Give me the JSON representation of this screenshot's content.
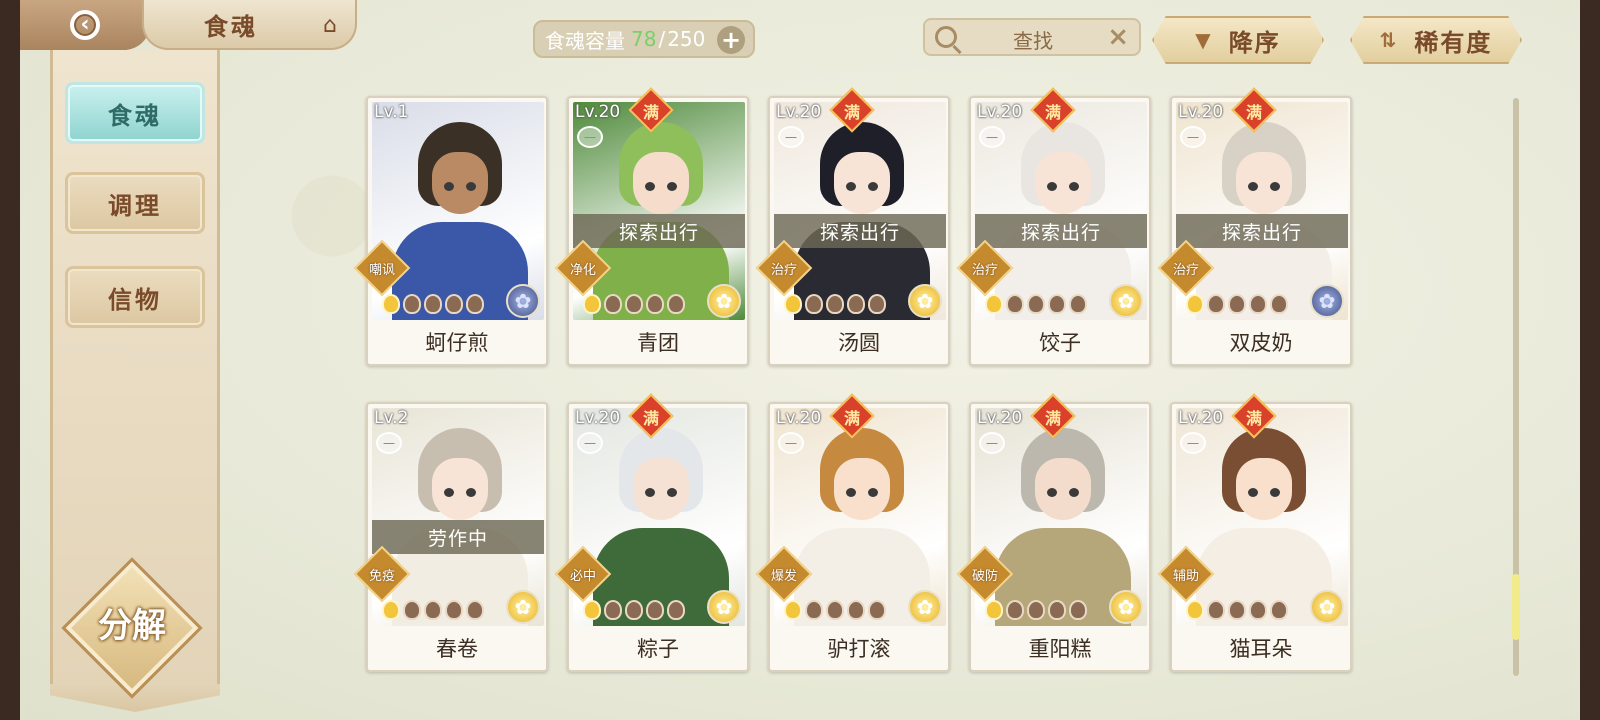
{
  "header": {
    "title": "食魂",
    "capacity_label": "食魂容量",
    "capacity_current": "78",
    "capacity_max": "250",
    "search_placeholder": "查找",
    "sort_order_label": "降序",
    "sort_by_label": "稀有度"
  },
  "sidebar": {
    "items": [
      {
        "label": "食魂",
        "active": true
      },
      {
        "label": "调理",
        "active": false
      },
      {
        "label": "信物",
        "active": false
      }
    ],
    "decompose_label": "分解"
  },
  "cards": [
    {
      "name": "蚵仔煎",
      "level": "Lv.1",
      "max": false,
      "badge": "",
      "status": "",
      "role": "嘲讽",
      "stars": 1,
      "rarity": "blue",
      "palette": {
        "bg": "#d9dde8",
        "hair": "#3b3025",
        "body": "#3a57a8",
        "skin": "#b98a63"
      }
    },
    {
      "name": "青团",
      "level": "Lv.20",
      "max": true,
      "max_label": "满",
      "badge": "一",
      "status": "探索出行",
      "role": "净化",
      "stars": 1,
      "rarity": "gold",
      "palette": {
        "bg": "#4e8a3a",
        "hair": "#8fbf5a",
        "body": "#7fb04a",
        "skin": "#f6dccb"
      }
    },
    {
      "name": "汤圆",
      "level": "Lv.20",
      "max": true,
      "max_label": "满",
      "badge": "一",
      "status": "探索出行",
      "role": "治疗",
      "stars": 1,
      "rarity": "gold",
      "palette": {
        "bg": "#efe7dc",
        "hair": "#1f1f2a",
        "body": "#2a2a33",
        "skin": "#f8e4d6"
      }
    },
    {
      "name": "饺子",
      "level": "Lv.20",
      "max": true,
      "max_label": "满",
      "badge": "一",
      "status": "探索出行",
      "role": "治疗",
      "stars": 1,
      "rarity": "gold",
      "palette": {
        "bg": "#ece8df",
        "hair": "#e9e6e2",
        "body": "#f2efea",
        "skin": "#f8e4d6"
      }
    },
    {
      "name": "双皮奶",
      "level": "Lv.20",
      "max": true,
      "max_label": "满",
      "badge": "一",
      "status": "探索出行",
      "role": "治疗",
      "stars": 1,
      "rarity": "blue",
      "palette": {
        "bg": "#efe4cf",
        "hair": "#d8d2c6",
        "body": "#f3efe8",
        "skin": "#f8e4d6"
      }
    },
    {
      "name": "春卷",
      "level": "Lv.2",
      "max": false,
      "badge": "一",
      "status": "劳作中",
      "role": "免疫",
      "stars": 1,
      "rarity": "gold",
      "palette": {
        "bg": "#e8e4d6",
        "hair": "#c8beb0",
        "body": "#f2ede2",
        "skin": "#f8e4d6"
      }
    },
    {
      "name": "粽子",
      "level": "Lv.20",
      "max": true,
      "max_label": "满",
      "badge": "一",
      "status": "",
      "role": "必中",
      "stars": 1,
      "rarity": "gold",
      "palette": {
        "bg": "#e3e6e0",
        "hair": "#e4e7ea",
        "body": "#3f6b3a",
        "skin": "#f6e2d4"
      }
    },
    {
      "name": "驴打滚",
      "level": "Lv.20",
      "max": true,
      "max_label": "满",
      "badge": "一",
      "status": "",
      "role": "爆发",
      "stars": 1,
      "rarity": "gold",
      "palette": {
        "bg": "#efe4cf",
        "hair": "#c58a3f",
        "body": "#f4efe6",
        "skin": "#f8e0cc"
      }
    },
    {
      "name": "重阳糕",
      "level": "Lv.20",
      "max": true,
      "max_label": "满",
      "badge": "一",
      "status": "",
      "role": "破防",
      "stars": 1,
      "rarity": "gold",
      "palette": {
        "bg": "#e6e2d4",
        "hair": "#bdb8ae",
        "body": "#b6a77a",
        "skin": "#f3dccb"
      }
    },
    {
      "name": "猫耳朵",
      "level": "Lv.20",
      "max": true,
      "max_label": "满",
      "badge": "一",
      "status": "",
      "role": "辅助",
      "stars": 1,
      "rarity": "gold",
      "palette": {
        "bg": "#efe6d6",
        "hair": "#7a4e32",
        "body": "#f4eee4",
        "skin": "#f8e0cc"
      }
    }
  ]
}
